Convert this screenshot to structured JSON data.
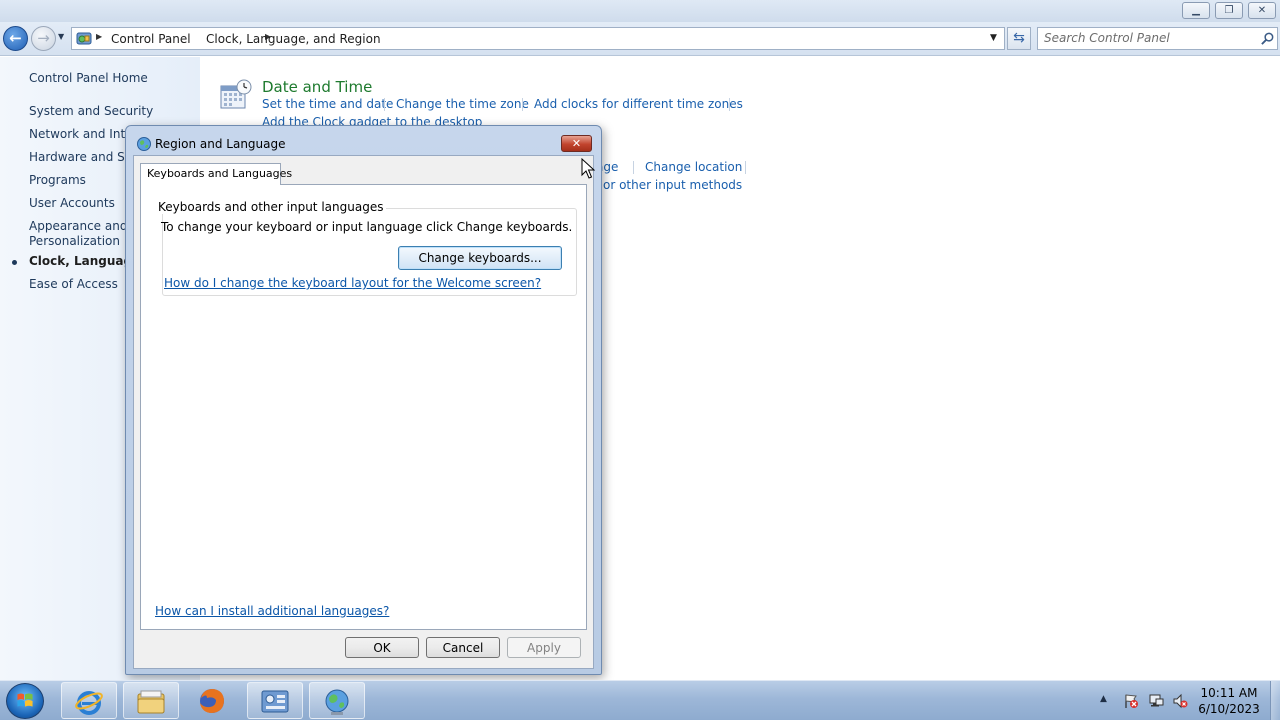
{
  "window": {
    "minimize_glyph": "▁",
    "maximize_glyph": "❐",
    "close_glyph": "✕"
  },
  "nav": {
    "back_glyph": "←",
    "forward_glyph": "→",
    "breadcrumb": [
      "Control Panel",
      "Clock, Language, and Region"
    ],
    "search_placeholder": "Search Control Panel"
  },
  "sidebar": {
    "home": "Control Panel Home",
    "items": [
      "System and Security",
      "Network and Inter",
      "Hardware and Sou",
      "Programs",
      "User Accounts",
      "Appearance and Personalization",
      "Clock, Language, a",
      "Ease of Access"
    ],
    "selected_index": 6
  },
  "content": {
    "date_time": {
      "title": "Date and Time",
      "links": [
        "Set the time and date",
        "Change the time zone",
        "Add clocks for different time zones",
        "Add the Clock gadget to the desktop"
      ]
    },
    "region_language": {
      "links": [
        "age",
        "Change location",
        "or other input methods"
      ]
    }
  },
  "dialog": {
    "title": "Region and Language",
    "close_glyph": "✕",
    "tab_label": "Keyboards and Languages",
    "group_title": "Keyboards and other input languages",
    "group_text": "To change your keyboard or input language click Change keyboards.",
    "change_keyboards_button": "Change keyboards...",
    "welcome_link": "How do I change the keyboard layout for the Welcome screen?",
    "install_link": "How can I install additional languages?",
    "ok_button": "OK",
    "cancel_button": "Cancel",
    "apply_button": "Apply"
  },
  "taskbar": {
    "pinned": [
      "internet-explorer-icon",
      "windows-explorer-icon",
      "firefox-icon",
      "control-panel-icon",
      "region-language-icon"
    ],
    "clock_time": "10:11 AM",
    "clock_date": "6/10/2023"
  },
  "colors": {
    "link": "#1a5fad",
    "section_title": "#1e7a2e",
    "taskbar": "#9db7d8",
    "dialog_frame": "#c6d6ec"
  }
}
